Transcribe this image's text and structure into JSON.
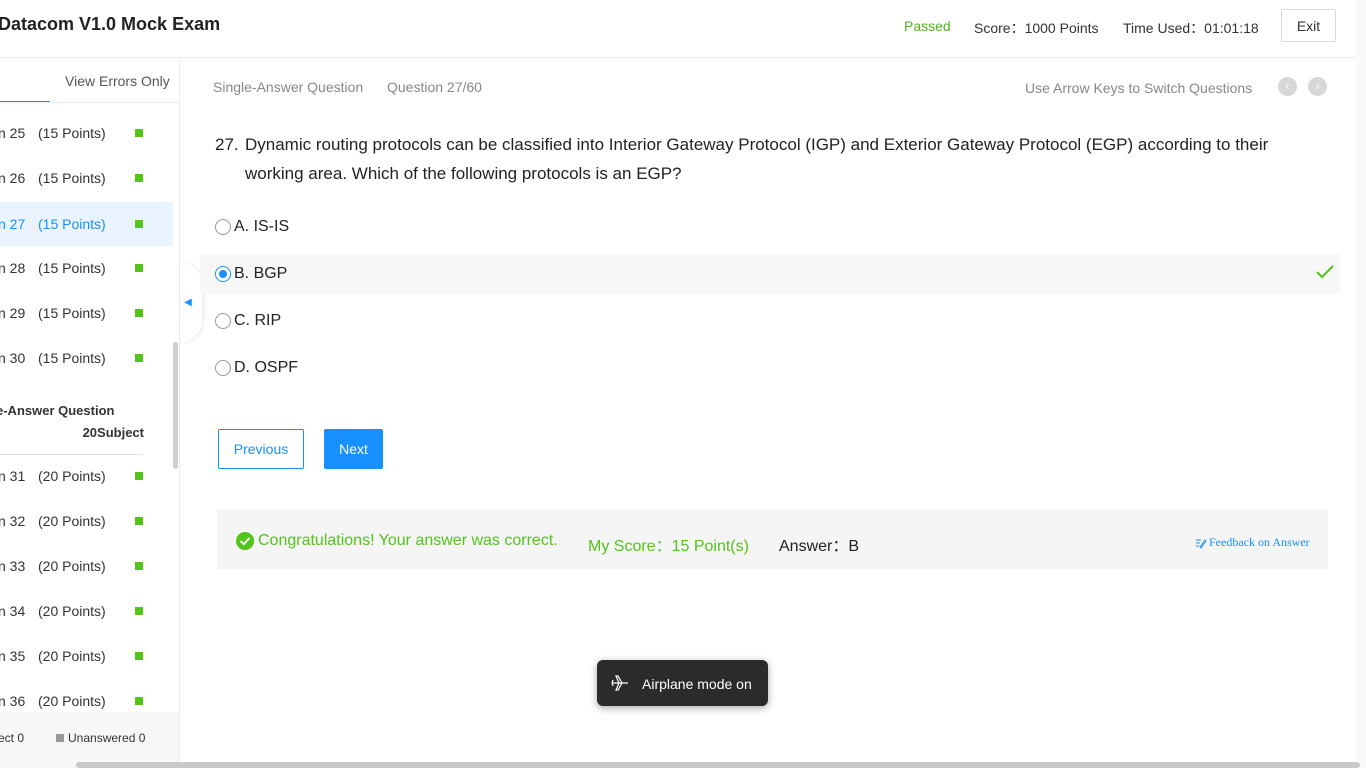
{
  "header": {
    "title": "Datacom V1.0 Mock Exam",
    "status": "Passed",
    "score": "Score：1000 Points",
    "time_used": "Time Used：01:01:18",
    "exit_label": "Exit"
  },
  "sidebar": {
    "filter_tab": "View Errors Only",
    "items_a": [
      {
        "num": "n 25",
        "points": "(15 Points)"
      },
      {
        "num": "n 26",
        "points": "(15 Points)"
      },
      {
        "num": "n 27",
        "points": "(15 Points)"
      },
      {
        "num": "n 28",
        "points": "(15 Points)"
      },
      {
        "num": "n 29",
        "points": "(15 Points)"
      },
      {
        "num": "n 30",
        "points": "(15 Points)"
      }
    ],
    "section": {
      "line1": "e-Answer Question",
      "line2": "20Subject"
    },
    "items_b": [
      {
        "num": "n 31",
        "points": "(20 Points)"
      },
      {
        "num": "n 32",
        "points": "(20 Points)"
      },
      {
        "num": "n 33",
        "points": "(20 Points)"
      },
      {
        "num": "n 34",
        "points": "(20 Points)"
      },
      {
        "num": "n 35",
        "points": "(20 Points)"
      },
      {
        "num": "n 36",
        "points": "(20 Points)"
      }
    ],
    "footer": {
      "correct": "ect 0",
      "unanswered": "Unanswered 0"
    },
    "collapse_glyph": "◀"
  },
  "question_header": {
    "type": "Single-Answer Question",
    "number": "Question 27/60",
    "hint": "Use Arrow Keys to Switch Questions",
    "prev_glyph": "‹",
    "next_glyph": "›"
  },
  "question": {
    "num": "27.",
    "text": "Dynamic routing protocols can be classified into Interior Gateway Protocol (IGP) and Exterior Gateway Protocol (EGP) according to their working area. Which of the following protocols is an EGP?"
  },
  "options": [
    {
      "label": "A. IS-IS"
    },
    {
      "label": "B. BGP"
    },
    {
      "label": "C. RIP"
    },
    {
      "label": "D. OSPF"
    }
  ],
  "buttons": {
    "previous": "Previous",
    "next": "Next"
  },
  "result": {
    "message": "Congratulations! Your answer was correct.",
    "my_score": "My Score：15 Point(s)",
    "answer": "Answer：B",
    "feedback": "Feedback on Answer"
  },
  "toast": {
    "label": "Airplane mode on",
    "icon": "airplane-icon"
  },
  "colors": {
    "accent": "#1890ff",
    "success": "#52c41a"
  }
}
